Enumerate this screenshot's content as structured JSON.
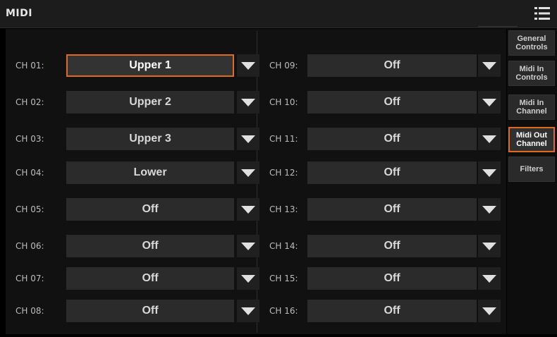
{
  "header": {
    "title": "MIDI",
    "menu_icon": "hamburger-menu-icon"
  },
  "accent_color": "#e06a1e",
  "channels_left": [
    {
      "label": "CH 01:",
      "value": "Upper 1",
      "selected": true
    },
    {
      "label": "CH 02:",
      "value": "Upper 2",
      "selected": false
    },
    {
      "label": "CH 03:",
      "value": "Upper 3",
      "selected": false
    },
    {
      "label": "CH 04:",
      "value": "Lower",
      "selected": false
    },
    {
      "label": "CH 05:",
      "value": "Off",
      "selected": false
    },
    {
      "label": "CH 06:",
      "value": "Off",
      "selected": false
    },
    {
      "label": "CH 07:",
      "value": "Off",
      "selected": false
    },
    {
      "label": "CH 08:",
      "value": "Off",
      "selected": false
    }
  ],
  "channels_right": [
    {
      "label": "CH 09:",
      "value": "Off",
      "selected": false
    },
    {
      "label": "CH 10:",
      "value": "Off",
      "selected": false
    },
    {
      "label": "CH 11:",
      "value": "Off",
      "selected": false
    },
    {
      "label": "CH 12:",
      "value": "Off",
      "selected": false
    },
    {
      "label": "CH 13:",
      "value": "Off",
      "selected": false
    },
    {
      "label": "CH 14:",
      "value": "Off",
      "selected": false
    },
    {
      "label": "CH 15:",
      "value": "Off",
      "selected": false
    },
    {
      "label": "CH 16:",
      "value": "Off",
      "selected": false
    }
  ],
  "tabs": [
    {
      "label": "General\nControls",
      "active": false
    },
    {
      "label": "Midi In\nControls",
      "active": false
    },
    {
      "label": "Midi In\nChannel",
      "active": false
    },
    {
      "label": "Midi Out\nChannel",
      "active": true
    },
    {
      "label": "Filters",
      "active": false
    }
  ]
}
